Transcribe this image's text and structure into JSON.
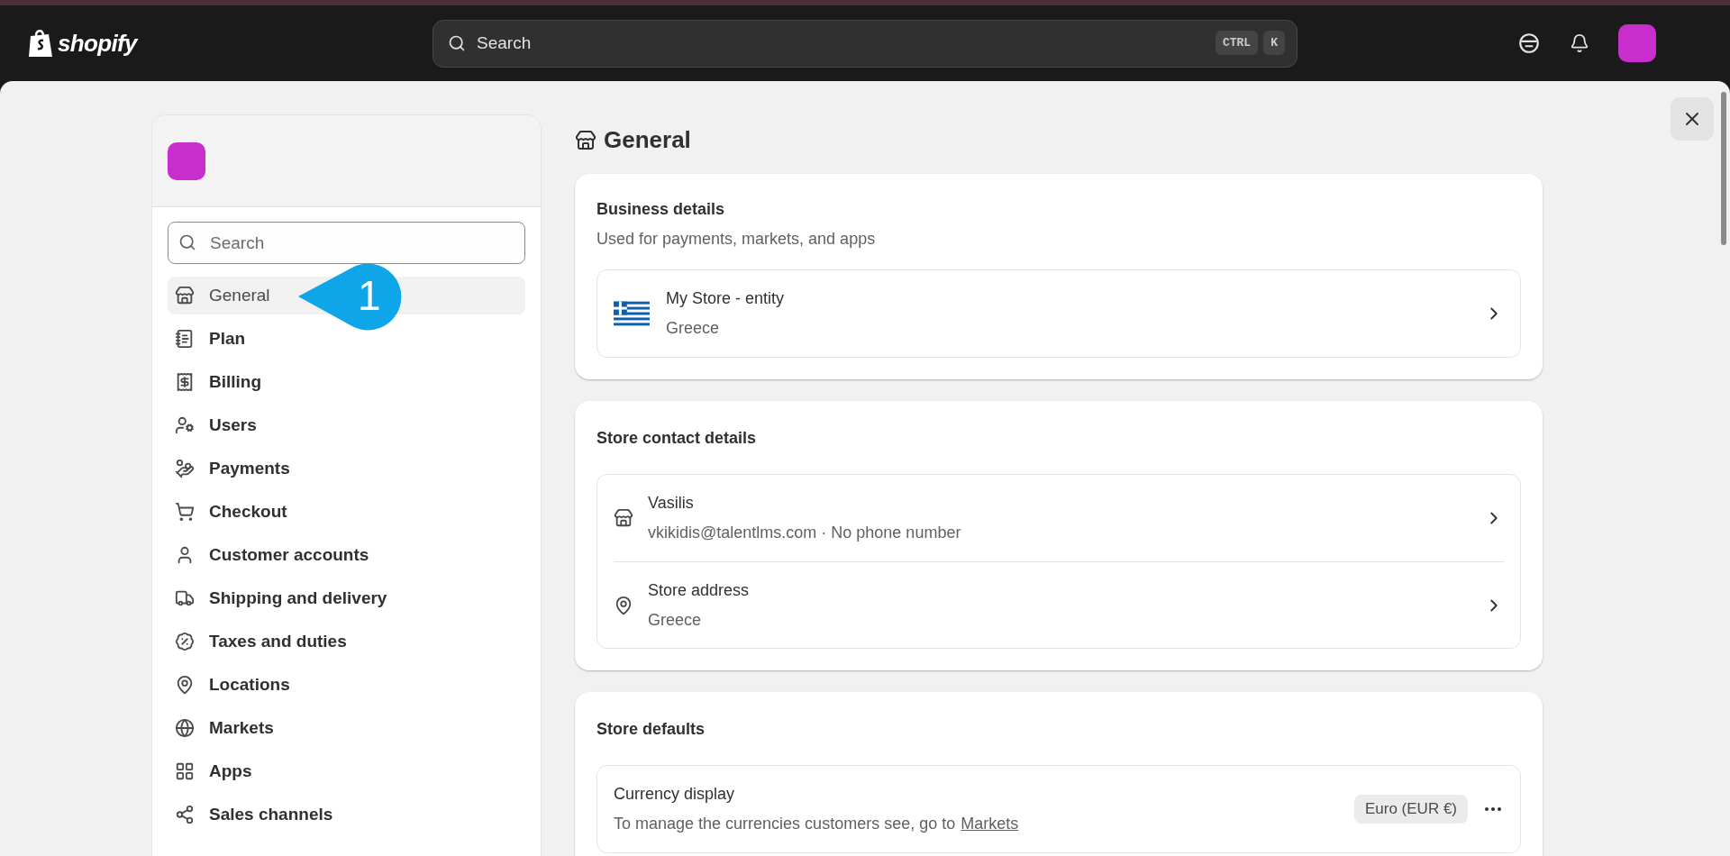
{
  "topbar": {
    "logo_text": "shopify",
    "search": {
      "placeholder": "Search",
      "keys": [
        "CTRL",
        "K"
      ]
    }
  },
  "sidebar": {
    "search": {
      "placeholder": "Search"
    },
    "items": [
      {
        "label": "General",
        "kind": "store",
        "selected": true
      },
      {
        "label": "Plan",
        "kind": "plan",
        "selected": false
      },
      {
        "label": "Billing",
        "kind": "billing",
        "selected": false
      },
      {
        "label": "Users",
        "kind": "users",
        "selected": false
      },
      {
        "label": "Payments",
        "kind": "payments",
        "selected": false
      },
      {
        "label": "Checkout",
        "kind": "checkout",
        "selected": false
      },
      {
        "label": "Customer accounts",
        "kind": "customer",
        "selected": false
      },
      {
        "label": "Shipping and delivery",
        "kind": "shipping",
        "selected": false
      },
      {
        "label": "Taxes and duties",
        "kind": "taxes",
        "selected": false
      },
      {
        "label": "Locations",
        "kind": "locations",
        "selected": false
      },
      {
        "label": "Markets",
        "kind": "markets",
        "selected": false
      },
      {
        "label": "Apps",
        "kind": "apps",
        "selected": false
      },
      {
        "label": "Sales channels",
        "kind": "channels",
        "selected": false
      }
    ]
  },
  "callout": {
    "number": "1"
  },
  "page": {
    "title": "General",
    "business_details": {
      "title": "Business details",
      "subtitle": "Used for payments, markets, and apps",
      "entity": {
        "name": "My Store - entity",
        "country": "Greece"
      }
    },
    "store_contact": {
      "title": "Store contact details",
      "rows": [
        {
          "kind": "store",
          "title": "Vasilis",
          "detail": "vkikidis@talentlms.com · No phone number"
        },
        {
          "kind": "address",
          "title": "Store address",
          "detail": "Greece"
        }
      ]
    },
    "store_defaults": {
      "title": "Store defaults",
      "currency": {
        "title": "Currency display",
        "text": "To manage the currencies customers see, go to",
        "link": "Markets",
        "badge": "Euro (EUR €)"
      }
    }
  }
}
